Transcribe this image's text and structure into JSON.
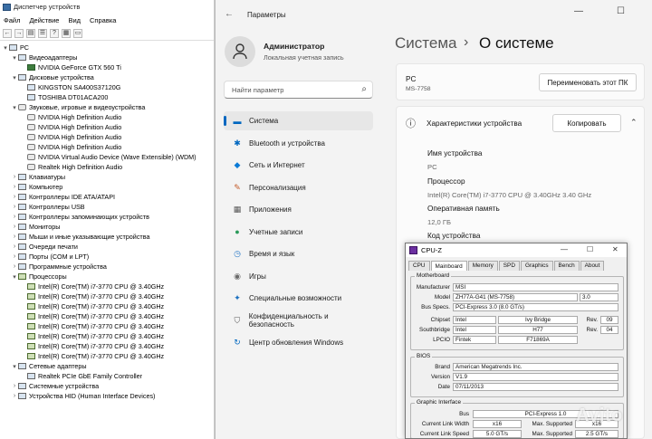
{
  "device_manager": {
    "title": "Диспетчер устройств",
    "menu": [
      "Файл",
      "Действие",
      "Вид",
      "Справка"
    ],
    "tree": [
      {
        "level": 0,
        "arrow": "▾",
        "icon": "computer-icon",
        "cls": "",
        "label": "PC"
      },
      {
        "level": 1,
        "arrow": "▾",
        "icon": "display-adapter-icon",
        "cls": "",
        "label": "Видеоадаптеры"
      },
      {
        "level": 2,
        "arrow": "",
        "icon": "gpu-icon",
        "cls": "gpu",
        "label": "NVIDIA GeForce GTX 560 Ti"
      },
      {
        "level": 1,
        "arrow": "▾",
        "icon": "disk-icon",
        "cls": "",
        "label": "Дисковые устройства"
      },
      {
        "level": 2,
        "arrow": "",
        "icon": "disk-icon",
        "cls": "",
        "label": "KINGSTON SA400S37120G"
      },
      {
        "level": 2,
        "arrow": "",
        "icon": "disk-icon",
        "cls": "",
        "label": "TOSHIBA DT01ACA200"
      },
      {
        "level": 1,
        "arrow": "▾",
        "icon": "sound-icon",
        "cls": "snd",
        "label": "Звуковые, игровые и видеоустройства"
      },
      {
        "level": 2,
        "arrow": "",
        "icon": "sound-icon",
        "cls": "snd",
        "label": "NVIDIA High Definition Audio"
      },
      {
        "level": 2,
        "arrow": "",
        "icon": "sound-icon",
        "cls": "snd",
        "label": "NVIDIA High Definition Audio"
      },
      {
        "level": 2,
        "arrow": "",
        "icon": "sound-icon",
        "cls": "snd",
        "label": "NVIDIA High Definition Audio"
      },
      {
        "level": 2,
        "arrow": "",
        "icon": "sound-icon",
        "cls": "snd",
        "label": "NVIDIA High Definition Audio"
      },
      {
        "level": 2,
        "arrow": "",
        "icon": "sound-icon",
        "cls": "snd",
        "label": "NVIDIA Virtual Audio Device (Wave Extensible) (WDM)"
      },
      {
        "level": 2,
        "arrow": "",
        "icon": "sound-icon",
        "cls": "snd",
        "label": "Realtek High Definition Audio"
      },
      {
        "level": 1,
        "arrow": "›",
        "icon": "keyboard-icon",
        "cls": "",
        "label": "Клавиатуры"
      },
      {
        "level": 1,
        "arrow": "›",
        "icon": "computer-icon",
        "cls": "",
        "label": "Компьютер"
      },
      {
        "level": 1,
        "arrow": "›",
        "icon": "controller-icon",
        "cls": "",
        "label": "Контроллеры IDE ATA/ATAPI"
      },
      {
        "level": 1,
        "arrow": "›",
        "icon": "usb-icon",
        "cls": "",
        "label": "Контроллеры USB"
      },
      {
        "level": 1,
        "arrow": "›",
        "icon": "storage-icon",
        "cls": "",
        "label": "Контроллеры запоминающих устройств"
      },
      {
        "level": 1,
        "arrow": "›",
        "icon": "monitor-icon",
        "cls": "",
        "label": "Мониторы"
      },
      {
        "level": 1,
        "arrow": "›",
        "icon": "mouse-icon",
        "cls": "",
        "label": "Мыши и иные указывающие устройства"
      },
      {
        "level": 1,
        "arrow": "›",
        "icon": "printer-icon",
        "cls": "",
        "label": "Очереди печати"
      },
      {
        "level": 1,
        "arrow": "›",
        "icon": "port-icon",
        "cls": "",
        "label": "Порты (COM и LPT)"
      },
      {
        "level": 1,
        "arrow": "›",
        "icon": "software-icon",
        "cls": "",
        "label": "Программные устройства"
      },
      {
        "level": 1,
        "arrow": "▾",
        "icon": "cpu-icon",
        "cls": "cpu",
        "label": "Процессоры"
      },
      {
        "level": 2,
        "arrow": "",
        "icon": "cpu-icon",
        "cls": "cpu",
        "label": "Intel(R) Core(TM) i7-3770 CPU @ 3.40GHz"
      },
      {
        "level": 2,
        "arrow": "",
        "icon": "cpu-icon",
        "cls": "cpu",
        "label": "Intel(R) Core(TM) i7-3770 CPU @ 3.40GHz"
      },
      {
        "level": 2,
        "arrow": "",
        "icon": "cpu-icon",
        "cls": "cpu",
        "label": "Intel(R) Core(TM) i7-3770 CPU @ 3.40GHz"
      },
      {
        "level": 2,
        "arrow": "",
        "icon": "cpu-icon",
        "cls": "cpu",
        "label": "Intel(R) Core(TM) i7-3770 CPU @ 3.40GHz"
      },
      {
        "level": 2,
        "arrow": "",
        "icon": "cpu-icon",
        "cls": "cpu",
        "label": "Intel(R) Core(TM) i7-3770 CPU @ 3.40GHz"
      },
      {
        "level": 2,
        "arrow": "",
        "icon": "cpu-icon",
        "cls": "cpu",
        "label": "Intel(R) Core(TM) i7-3770 CPU @ 3.40GHz"
      },
      {
        "level": 2,
        "arrow": "",
        "icon": "cpu-icon",
        "cls": "cpu",
        "label": "Intel(R) Core(TM) i7-3770 CPU @ 3.40GHz"
      },
      {
        "level": 2,
        "arrow": "",
        "icon": "cpu-icon",
        "cls": "cpu",
        "label": "Intel(R) Core(TM) i7-3770 CPU @ 3.40GHz"
      },
      {
        "level": 1,
        "arrow": "▾",
        "icon": "network-icon",
        "cls": "",
        "label": "Сетевые адаптеры"
      },
      {
        "level": 2,
        "arrow": "",
        "icon": "network-icon",
        "cls": "",
        "label": "Realtek PCIe GbE Family Controller"
      },
      {
        "level": 1,
        "arrow": "›",
        "icon": "system-icon",
        "cls": "",
        "label": "Системные устройства"
      },
      {
        "level": 1,
        "arrow": "›",
        "icon": "hid-icon",
        "cls": "",
        "label": "Устройства HID (Human Interface Devices)"
      }
    ]
  },
  "settings": {
    "title": "Параметры",
    "user_name": "Администратор",
    "user_sub": "Локальная учетная запись",
    "search_placeholder": "Найти параметр",
    "nav": [
      {
        "label": "Система",
        "icon": "▬",
        "active": true
      },
      {
        "label": "Bluetooth и устройства",
        "icon": "✱"
      },
      {
        "label": "Сеть и Интернет",
        "icon": "◆"
      },
      {
        "label": "Персонализация",
        "icon": "✎"
      },
      {
        "label": "Приложения",
        "icon": "▦"
      },
      {
        "label": "Учетные записи",
        "icon": "●"
      },
      {
        "label": "Время и язык",
        "icon": "◷"
      },
      {
        "label": "Игры",
        "icon": "◉"
      },
      {
        "label": "Специальные возможности",
        "icon": "✦"
      },
      {
        "label": "Конфиденциальность и безопасность",
        "icon": "⛉"
      },
      {
        "label": "Центр обновления Windows",
        "icon": "↻"
      }
    ],
    "crumb_parent": "Система",
    "crumb_sep": "›",
    "crumb_current": "О системе",
    "pc_name": "PC",
    "pc_model": "MS-7758",
    "rename_button": "Переименовать этот ПК",
    "specs_title": "Характеристики устройства",
    "copy_button": "Копировать",
    "specs": [
      {
        "label": "Имя устройства",
        "value": "PC"
      },
      {
        "label": "Процессор",
        "value": "Intel(R) Core(TM) i7-3770 CPU @ 3.40GHz   3.40 GHz"
      },
      {
        "label": "Оперативная память",
        "value": "12,0 ГБ"
      },
      {
        "label": "Код устройства",
        "value": ""
      }
    ]
  },
  "cpuz": {
    "title": "CPU-Z",
    "tabs": [
      "CPU",
      "Mainboard",
      "Memory",
      "SPD",
      "Graphics",
      "Bench",
      "About"
    ],
    "active_tab": "Mainboard",
    "motherboard_title": "Motherboard",
    "manufacturer_label": "Manufacturer",
    "manufacturer": "MSI",
    "model_label": "Model",
    "model": "ZH77A-G41 (MS-7758)",
    "model_rev": "3.0",
    "busspecs_label": "Bus Specs.",
    "busspecs": "PCI-Express 3.0 (8.0 GT/s)",
    "chipset_label": "Chipset",
    "chipset_vendor": "Intel",
    "chipset_name": "Ivy Bridge",
    "chipset_rev_label": "Rev.",
    "chipset_rev": "09",
    "southbridge_label": "Southbridge",
    "south_vendor": "Intel",
    "south_name": "H77",
    "south_rev_label": "Rev.",
    "south_rev": "04",
    "lpcio_label": "LPCIO",
    "lpcio_vendor": "Fintek",
    "lpcio_name": "F71869A",
    "bios_title": "BIOS",
    "brand_label": "Brand",
    "brand": "American Megatrends Inc.",
    "version_label": "Version",
    "version": "V1.9",
    "date_label": "Date",
    "date": "07/11/2013",
    "gi_title": "Graphic Interface",
    "bus_label": "Bus",
    "bus": "PCI-Express 1.0",
    "clw_label": "Current Link Width",
    "clw": "x16",
    "mxs_label": "Max. Supported",
    "mxs": "x16",
    "cls_label": "Current Link Speed",
    "cls": "5.0 GT/s",
    "mss_label": "Max. Supported",
    "mss": "2.5 GT/s"
  },
  "watermark": "Avito"
}
